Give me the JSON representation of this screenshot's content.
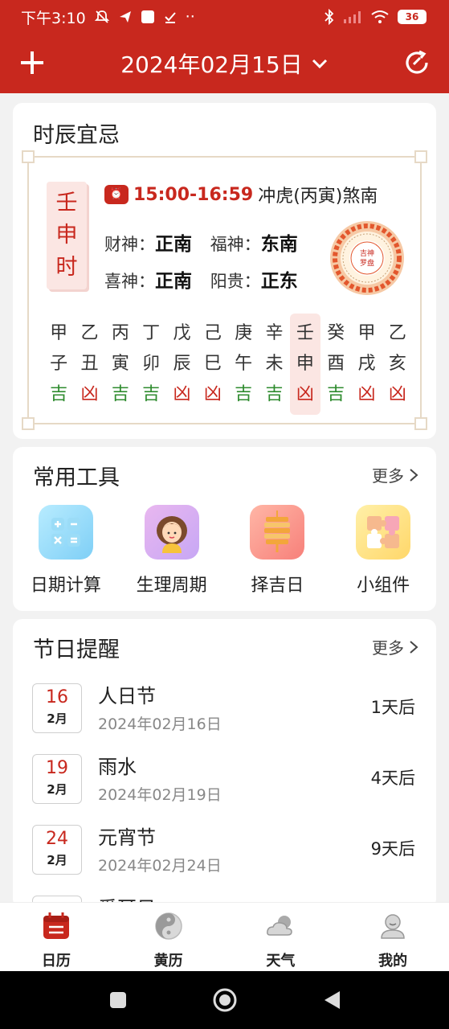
{
  "status_bar": {
    "time": "下午3:10",
    "battery": "36"
  },
  "header": {
    "date_title": "2024年02月15日"
  },
  "shichen": {
    "title": "时辰宜忌",
    "seal": [
      "壬",
      "申",
      "时"
    ],
    "clock_badge": "⏰",
    "time_range": "15:00-16:59",
    "chong_sha": "冲虎(丙寅)煞南",
    "gods": [
      {
        "label": "财神：",
        "value": "正南"
      },
      {
        "label": "福神：",
        "value": "东南"
      },
      {
        "label": "喜神：",
        "value": "正南"
      },
      {
        "label": "阳贵：",
        "value": "正东"
      }
    ],
    "compass_center": [
      "吉神",
      "罗盘"
    ],
    "hours": [
      {
        "gan": "甲",
        "zhi": "子",
        "luck": "吉"
      },
      {
        "gan": "乙",
        "zhi": "丑",
        "luck": "凶"
      },
      {
        "gan": "丙",
        "zhi": "寅",
        "luck": "吉"
      },
      {
        "gan": "丁",
        "zhi": "卯",
        "luck": "吉"
      },
      {
        "gan": "戊",
        "zhi": "辰",
        "luck": "凶"
      },
      {
        "gan": "己",
        "zhi": "巳",
        "luck": "凶"
      },
      {
        "gan": "庚",
        "zhi": "午",
        "luck": "吉"
      },
      {
        "gan": "辛",
        "zhi": "未",
        "luck": "吉"
      },
      {
        "gan": "壬",
        "zhi": "申",
        "luck": "凶"
      },
      {
        "gan": "癸",
        "zhi": "酉",
        "luck": "吉"
      },
      {
        "gan": "甲",
        "zhi": "戌",
        "luck": "凶"
      },
      {
        "gan": "乙",
        "zhi": "亥",
        "luck": "凶"
      }
    ],
    "active_index": 8,
    "colors": {
      "good": "#2e8b2e",
      "bad": "#c8281e"
    }
  },
  "tools": {
    "title": "常用工具",
    "more": "更多",
    "items": [
      {
        "label": "日期计算",
        "icon": "calculator-icon"
      },
      {
        "label": "生理周期",
        "icon": "woman-avatar-icon"
      },
      {
        "label": "择吉日",
        "icon": "lantern-icon"
      },
      {
        "label": "小组件",
        "icon": "puzzle-icon"
      }
    ]
  },
  "festivals": {
    "title": "节日提醒",
    "more": "更多",
    "items": [
      {
        "day": "16",
        "month": "2月",
        "name": "人日节",
        "date": "2024年02月16日",
        "countdown": "1天后"
      },
      {
        "day": "19",
        "month": "2月",
        "name": "雨水",
        "date": "2024年02月19日",
        "countdown": "4天后"
      },
      {
        "day": "24",
        "month": "2月",
        "name": "元宵节",
        "date": "2024年02月24日",
        "countdown": "9天后"
      },
      {
        "day": "",
        "month": "",
        "name": "爱耳日",
        "date": "",
        "countdown": ""
      }
    ]
  },
  "bottom_nav": {
    "items": [
      {
        "label": "日历",
        "icon": "calendar-icon",
        "active": true
      },
      {
        "label": "黄历",
        "icon": "yin-yang-icon",
        "active": false
      },
      {
        "label": "天气",
        "icon": "weather-icon",
        "active": false
      },
      {
        "label": "我的",
        "icon": "profile-icon",
        "active": false
      }
    ]
  },
  "brand_color": "#c8281e"
}
